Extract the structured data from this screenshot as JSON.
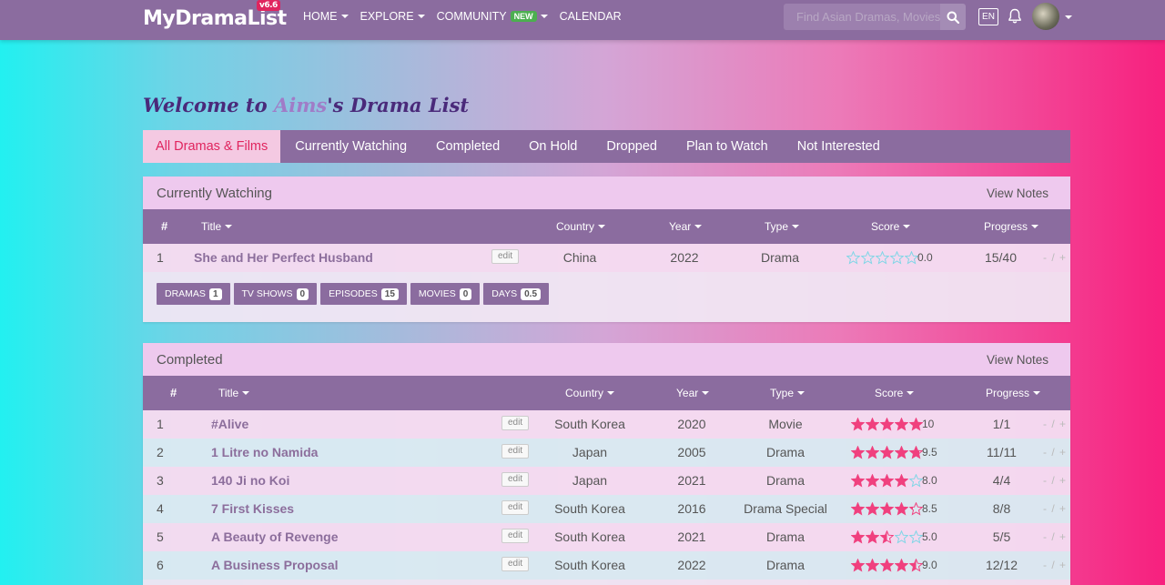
{
  "nav": {
    "logo": "MyDramaList",
    "version": "v6.6",
    "items": [
      {
        "label": "HOME"
      },
      {
        "label": "EXPLORE"
      },
      {
        "label": "COMMUNITY",
        "badge": "NEW"
      },
      {
        "label": "CALENDAR"
      }
    ],
    "search_placeholder": "Find Asian Dramas, Movies",
    "lang": "EN"
  },
  "welcome": {
    "prefix": "Welcome to ",
    "user": "Aims",
    "suffix": "'s Drama List"
  },
  "tabs": [
    "All Dramas & Films",
    "Currently Watching",
    "Completed",
    "On Hold",
    "Dropped",
    "Plan to Watch",
    "Not Interested"
  ],
  "colors": {
    "nav_bg": "#8b6c9f",
    "accent": "#e0245e",
    "star_fill": "#f0407e",
    "star_empty": "#7fd6e6"
  },
  "watching": {
    "title": "Currently Watching",
    "view_notes": "View Notes",
    "headers": {
      "num": "#",
      "title": "Title",
      "country": "Country",
      "year": "Year",
      "type": "Type",
      "score": "Score",
      "progress": "Progress"
    },
    "rows": [
      {
        "num": "1",
        "title": "She and Her Perfect Husband",
        "edit": "edit",
        "country": "China",
        "year": "2022",
        "type": "Drama",
        "score": "0.0",
        "stars": 0,
        "progress": "15/40",
        "pm": "- / +"
      }
    ],
    "stats": [
      {
        "label": "DRAMAS",
        "count": "1"
      },
      {
        "label": "TV SHOWS",
        "count": "0"
      },
      {
        "label": "EPISODES",
        "count": "15"
      },
      {
        "label": "MOVIES",
        "count": "0"
      },
      {
        "label": "DAYS",
        "count": "0.5"
      }
    ]
  },
  "completed": {
    "title": "Completed",
    "view_notes": "View Notes",
    "headers": {
      "num": "#",
      "title": "Title",
      "country": "Country",
      "year": "Year",
      "type": "Type",
      "score": "Score",
      "progress": "Progress"
    },
    "rows": [
      {
        "num": "1",
        "title": "#Alive",
        "edit": "edit",
        "country": "South Korea",
        "year": "2020",
        "type": "Movie",
        "score": "10",
        "stars": 5,
        "progress": "1/1",
        "pm": "- / +"
      },
      {
        "num": "2",
        "title": "1 Litre no Namida",
        "edit": "edit",
        "country": "Japan",
        "year": "2005",
        "type": "Drama",
        "score": "9.5",
        "stars": 4.75,
        "progress": "11/11",
        "pm": "- / +"
      },
      {
        "num": "3",
        "title": "140 Ji no Koi",
        "edit": "edit",
        "country": "Japan",
        "year": "2021",
        "type": "Drama",
        "score": "8.0",
        "stars": 4,
        "progress": "4/4",
        "pm": "- / +"
      },
      {
        "num": "4",
        "title": "7 First Kisses",
        "edit": "edit",
        "country": "South Korea",
        "year": "2016",
        "type": "Drama Special",
        "score": "8.5",
        "stars": 4.25,
        "progress": "8/8",
        "pm": "- / +"
      },
      {
        "num": "5",
        "title": "A Beauty of Revenge",
        "edit": "edit",
        "country": "South Korea",
        "year": "2021",
        "type": "Drama",
        "score": "5.0",
        "stars": 2.5,
        "progress": "5/5",
        "pm": "- / +"
      },
      {
        "num": "6",
        "title": "A Business Proposal",
        "edit": "edit",
        "country": "South Korea",
        "year": "2022",
        "type": "Drama",
        "score": "9.0",
        "stars": 4.5,
        "progress": "12/12",
        "pm": "- / +"
      }
    ]
  }
}
